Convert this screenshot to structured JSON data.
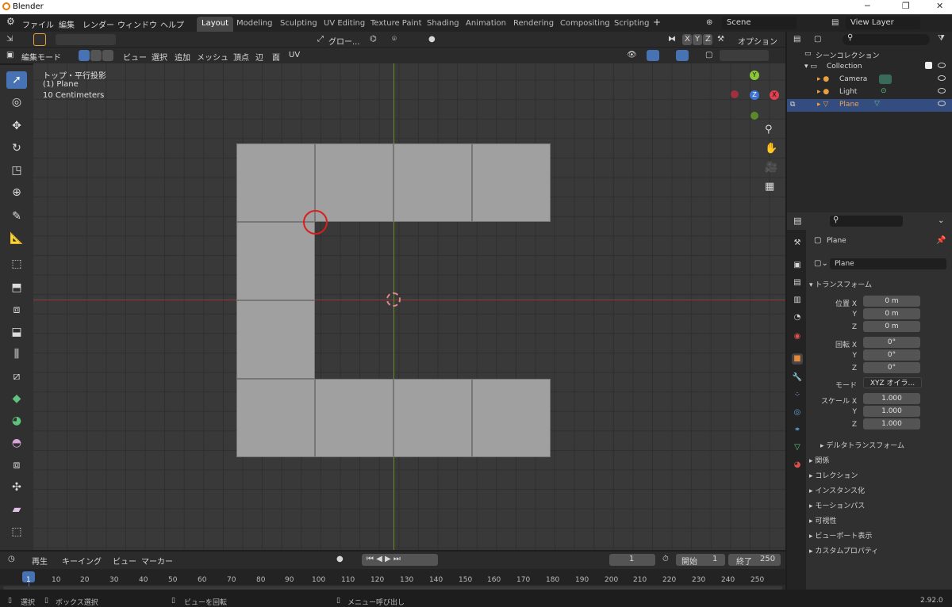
{
  "window": {
    "title": "Blender",
    "version": "2.92.0"
  },
  "menu": [
    "ファイル",
    "編集",
    "レンダー",
    "ウィンドウ",
    "ヘルプ"
  ],
  "workspaces": [
    "Layout",
    "Modeling",
    "Sculpting",
    "UV Editing",
    "Texture Paint",
    "Shading",
    "Animation",
    "Rendering",
    "Compositing",
    "Scripting"
  ],
  "scene": {
    "label": "Scene",
    "view_layer": "View Layer"
  },
  "tool_header": {
    "transform": "グロー...",
    "options": "オプション",
    "axes": [
      "X",
      "Y",
      "Z"
    ]
  },
  "view_header": {
    "mode": "編集モード",
    "items": [
      "ビュー",
      "選択",
      "追加",
      "メッシュ",
      "頂点",
      "辺",
      "面",
      "UV"
    ]
  },
  "viewport": {
    "view_name": "トップ・平行投影",
    "object": "(1) Plane",
    "scale": "10 Centimeters",
    "gizmo": {
      "x": "X",
      "y": "Y",
      "z": "Z"
    }
  },
  "outliner": {
    "root": "シーンコレクション",
    "collection": "Collection",
    "items": [
      "Camera",
      "Light",
      "Plane"
    ]
  },
  "properties": {
    "object_name": "Plane",
    "data_name": "Plane",
    "section_transform": "トランスフォーム",
    "location_label": "位置 X",
    "rotation_label": "回転 X",
    "scale_label": "スケール X",
    "mode_label": "モード",
    "y": "Y",
    "z": "Z",
    "location": [
      "0 m",
      "0 m",
      "0 m"
    ],
    "rotation": [
      "0°",
      "0°",
      "0°"
    ],
    "scale": [
      "1.000",
      "1.000",
      "1.000"
    ],
    "mode": "XYZ オイラ...",
    "delta": "デルタトランスフォーム",
    "panels": [
      "関係",
      "コレクション",
      "インスタンス化",
      "モーションパス",
      "可視性",
      "ビューポート表示",
      "カスタムプロパティ"
    ]
  },
  "timeline": {
    "menus": [
      "再生",
      "キーイング",
      "ビュー",
      "マーカー"
    ],
    "current_frame": "1",
    "start_label": "開始",
    "start": "1",
    "end_label": "終了",
    "end": "250",
    "ticks": [
      "1",
      "10",
      "20",
      "30",
      "40",
      "50",
      "60",
      "70",
      "80",
      "90",
      "100",
      "110",
      "120",
      "130",
      "140",
      "150",
      "160",
      "170",
      "180",
      "190",
      "200",
      "210",
      "220",
      "230",
      "240",
      "250"
    ]
  },
  "status": {
    "select": "選択",
    "box_select": "ボックス選択",
    "rotate": "ビューを回転",
    "menu": "メニュー呼び出し"
  }
}
